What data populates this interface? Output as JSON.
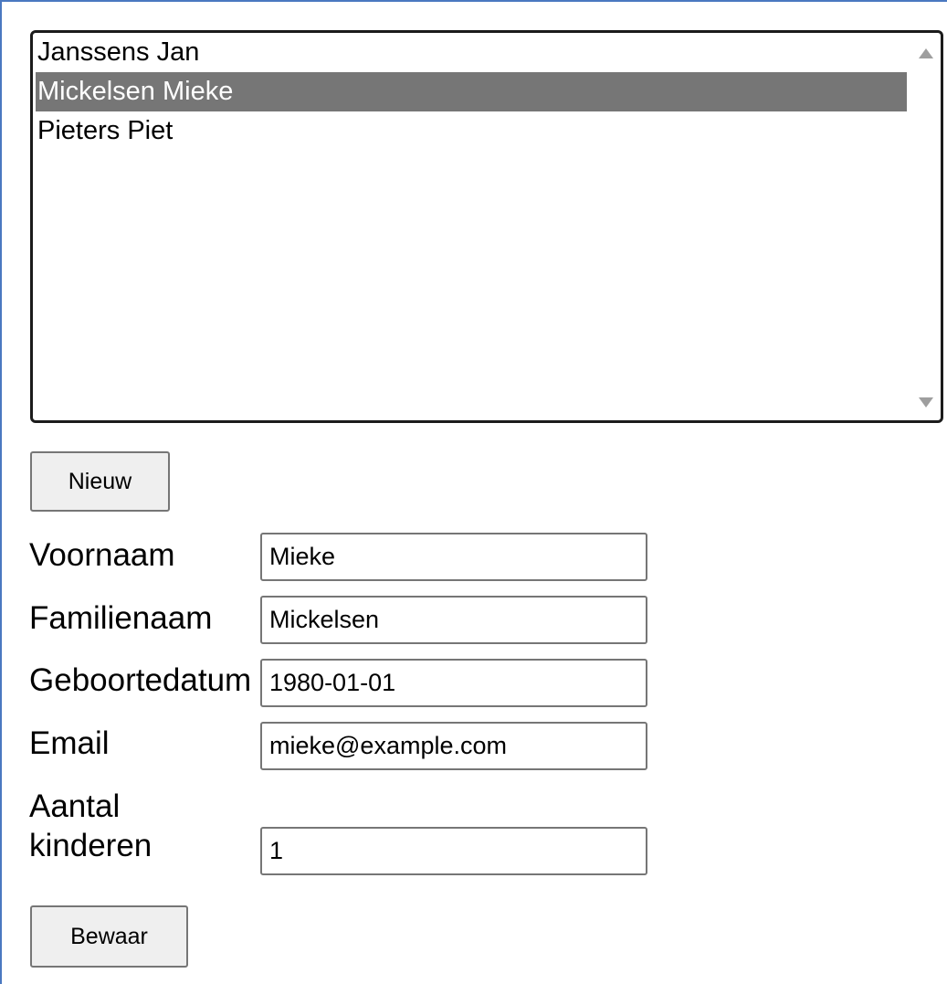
{
  "list": {
    "items": [
      {
        "label": "Janssens Jan",
        "selected": false
      },
      {
        "label": "Mickelsen Mieke",
        "selected": true
      },
      {
        "label": "Pieters Piet",
        "selected": false
      }
    ]
  },
  "buttons": {
    "new_label": "Nieuw",
    "save_label": "Bewaar"
  },
  "form": {
    "firstname": {
      "label": "Voornaam",
      "value": "Mieke"
    },
    "lastname": {
      "label": "Familienaam",
      "value": "Mickelsen"
    },
    "birthdate": {
      "label": "Geboortedatum",
      "value": "1980-01-01"
    },
    "email": {
      "label": "Email",
      "value": "mieke@example.com"
    },
    "children": {
      "label": "Aantal kinderen",
      "value": "1"
    }
  },
  "colors": {
    "selection_bg": "#767676",
    "frame_border": "#4a78c0"
  }
}
